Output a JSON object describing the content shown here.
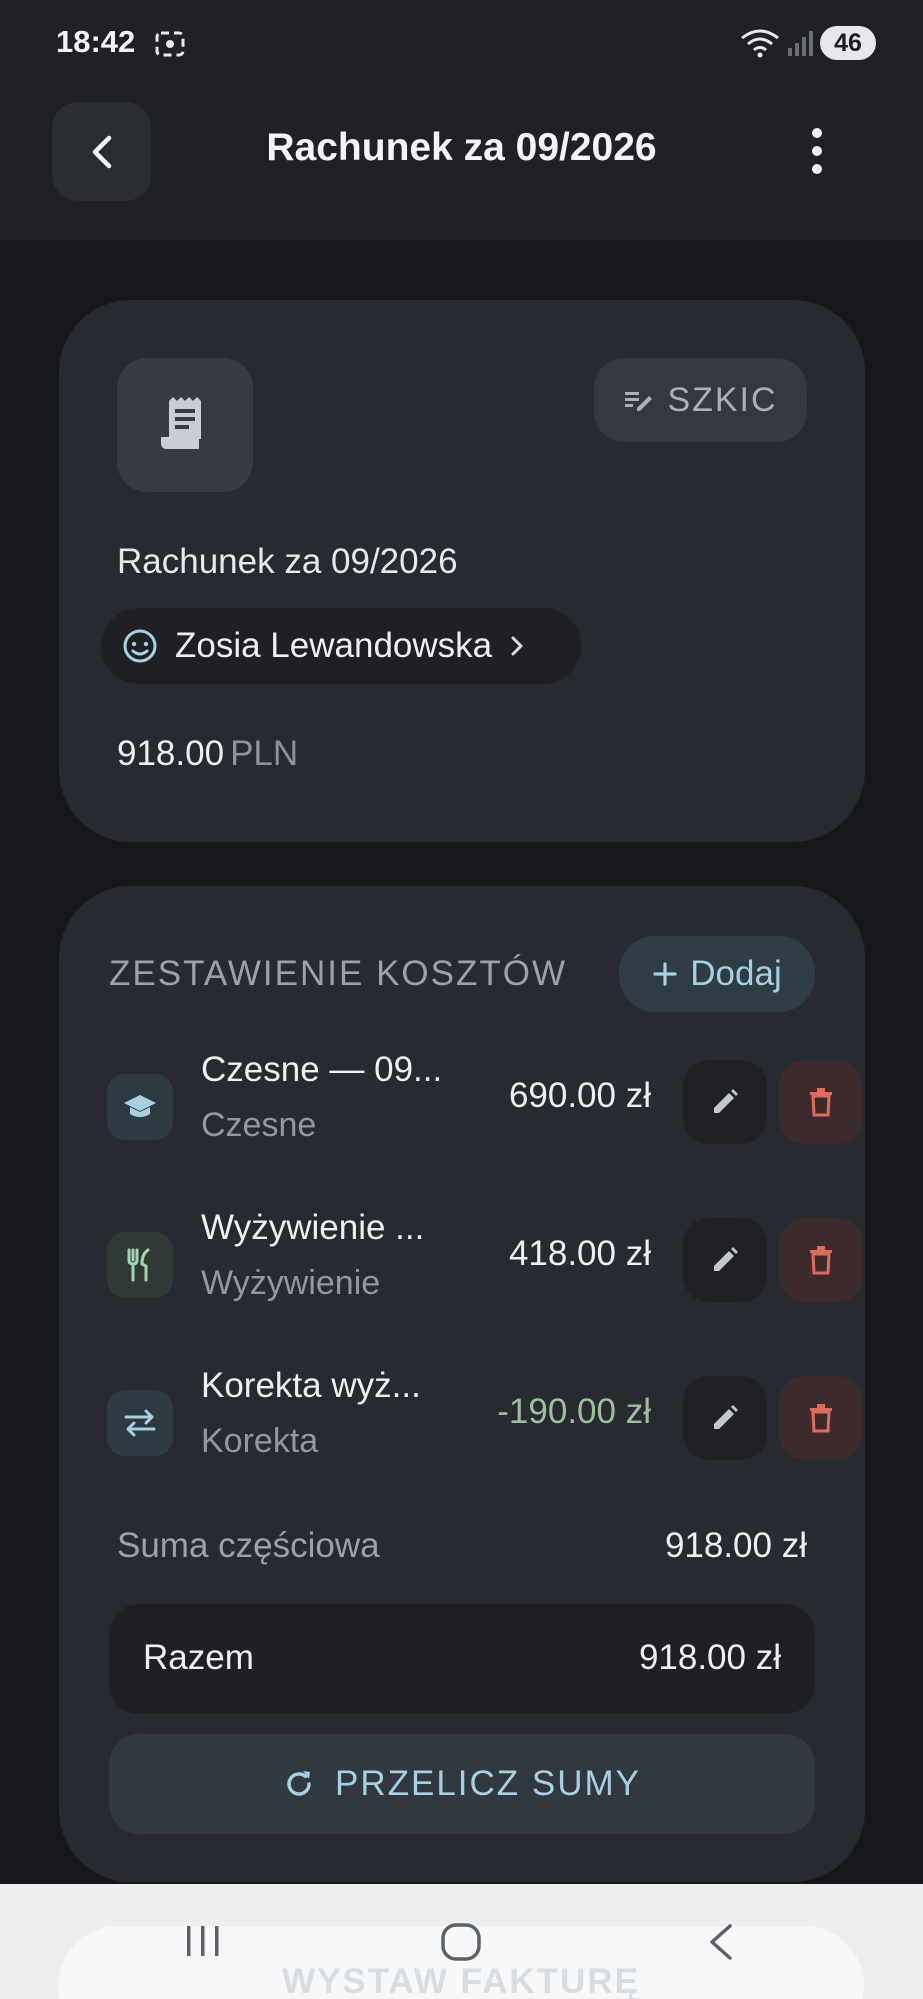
{
  "status": {
    "time": "18:42",
    "battery": "46"
  },
  "appbar": {
    "title": "Rachunek za 09/2026"
  },
  "header_card": {
    "status_chip": "SZKIC",
    "bill_name": "Rachunek za 09/2026",
    "client_name": "Zosia Lewandowska",
    "amount": "918.00",
    "currency": "PLN"
  },
  "costs": {
    "section_title": "ZESTAWIENIE KOSZTÓW",
    "add_label": "Dodaj",
    "items": [
      {
        "title": "Czesne — 09...",
        "subtitle": "Czesne",
        "amount": "690.00 zł",
        "icon": "graduation-cap-icon"
      },
      {
        "title": "Wyżywienie ...",
        "subtitle": "Wyżywienie",
        "amount": "418.00 zł",
        "icon": "cutlery-icon"
      },
      {
        "title": "Korekta wyż...",
        "subtitle": "Korekta",
        "amount": "-190.00 zł",
        "icon": "swap-arrows-icon"
      }
    ],
    "subtotal_label": "Suma częściowa",
    "subtotal_value": "918.00 zł",
    "total_label": "Razem",
    "total_value": "918.00 zł",
    "recalc_label": "PRZELICZ SUMY"
  },
  "footer": {
    "issue_invoice_label": "WYSTAW FAKTURĘ"
  },
  "colors": {
    "background": "#17181b",
    "card": "#272a30",
    "accent": "#a9cfe3",
    "danger": "#e06a5f",
    "positive_correction": "#9cbf9c"
  }
}
